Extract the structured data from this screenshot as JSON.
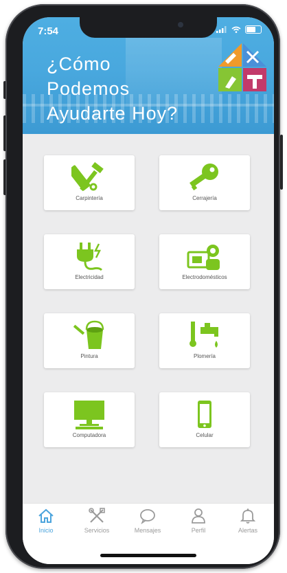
{
  "status_bar": {
    "time": "7:54"
  },
  "header": {
    "headline_line1": "¿Cómo",
    "headline_line2": "Podemos",
    "headline_line3": "Ayudarte Hoy?"
  },
  "colors": {
    "accent_green": "#7cc51f",
    "header_blue": "#4aa8de",
    "tab_active": "#4aa3dc",
    "tab_inactive": "#9a9a9a"
  },
  "services": [
    {
      "label": "Carpintería",
      "icon": "carpentry-icon"
    },
    {
      "label": "Cerrajería",
      "icon": "key-icon"
    },
    {
      "label": "Electricidad",
      "icon": "electric-plug-icon"
    },
    {
      "label": "Electrodomésticos",
      "icon": "appliance-repair-icon"
    },
    {
      "label": "Pintura",
      "icon": "paint-bucket-icon"
    },
    {
      "label": "Plomería",
      "icon": "faucet-icon"
    },
    {
      "label": "Computadora",
      "icon": "computer-icon"
    },
    {
      "label": "Celular",
      "icon": "cellphone-icon"
    }
  ],
  "tabbar": {
    "items": [
      {
        "label": "Inicio",
        "icon": "home-icon",
        "active": true
      },
      {
        "label": "Servicios",
        "icon": "tools-icon",
        "active": false
      },
      {
        "label": "Mensajes",
        "icon": "chat-bubble-icon",
        "active": false
      },
      {
        "label": "Perfil",
        "icon": "user-icon",
        "active": false
      },
      {
        "label": "Alertas",
        "icon": "bell-icon",
        "active": false
      }
    ]
  }
}
